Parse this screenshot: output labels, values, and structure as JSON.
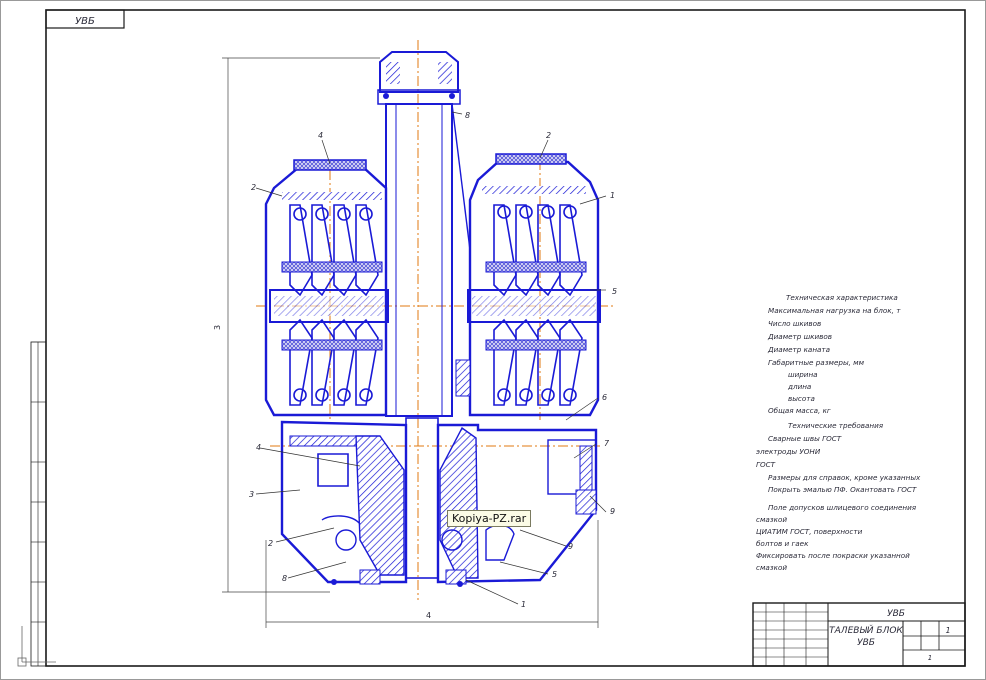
{
  "drawing": {
    "code_stamp": "УВБ",
    "title_block": {
      "code": "УВБ",
      "title_line1": "ТАЛЕВЫЙ БЛОК",
      "title_line2": "УВБ",
      "sheet": "1",
      "scale": "1"
    },
    "tech_specs": [
      "Техническая характеристика",
      "Максимальная нагрузка на блок, т",
      "Число шкивов",
      "Диаметр шкивов",
      "Диаметр каната",
      "Габаритные размеры, мм",
      "ширина",
      "длина",
      "высота",
      "Общая масса, кг"
    ],
    "tech_requirements": [
      "Технические требования",
      "Сварные швы ГОСТ",
      "электроды УОНИ",
      "ГОСТ",
      "Размеры для справок, кроме указанных",
      "Покрыть эмалью ПФ. Окантовать ГОСТ",
      "Поле допусков шлицевого соединения",
      "смазкой",
      "ЦИАТИМ ГОСТ, поверхности",
      "болтов и гаек",
      "Фиксировать после покраски указанной",
      "смазкой"
    ],
    "callouts": [
      "1",
      "2",
      "3",
      "4",
      "5",
      "6",
      "7",
      "8",
      "9"
    ],
    "dimensions": {
      "height_label": "3",
      "width_label": "4"
    },
    "tooltip": "Kopiya-PZ.rar",
    "colors": {
      "line": "#1a1ad6",
      "axis": "#e07a10",
      "frame": "#1a1a1a"
    }
  }
}
